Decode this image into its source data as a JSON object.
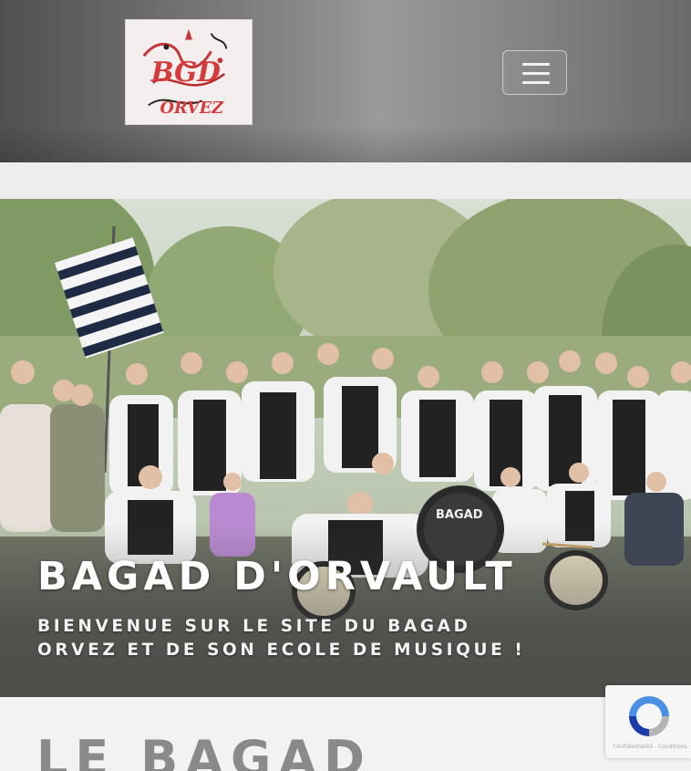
{
  "header": {
    "logo_text_top": "BGD",
    "logo_text_bottom": "ORVEZ",
    "menu_toggle_label": "Menu"
  },
  "hero": {
    "title": "BAGAD D'ORVAULT",
    "subtitle_line1": "Bienvenue sur le site du Bagad",
    "subtitle_line2": "Orvez et de son ecole de musique !",
    "drum_text": "BAGAD"
  },
  "section": {
    "title": "LE BAGAD"
  },
  "recaptcha": {
    "terms": "Confidentialité - Conditions"
  },
  "colors": {
    "header_bg": "#7a7a7a",
    "logo_red": "#d63a3a",
    "hero_text": "#ffffff",
    "section_title": "#8a8a8a"
  },
  "icons": [
    "hamburger-menu-icon",
    "recaptcha-icon"
  ]
}
